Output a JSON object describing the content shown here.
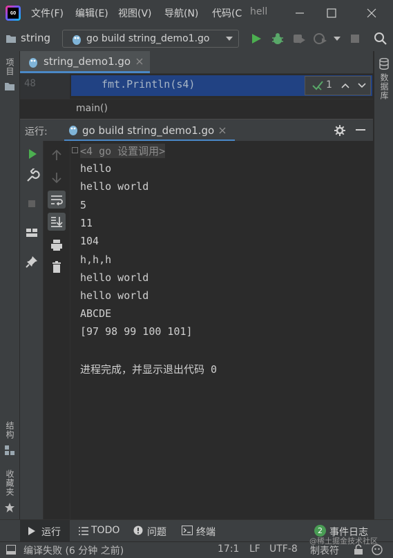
{
  "menu": [
    "文件(F)",
    "编辑(E)",
    "视图(V)",
    "导航(N)",
    "代码(C"
  ],
  "window_title": "hell",
  "toolbar": {
    "project_name": "string",
    "run_config": "go build string_demo1.go"
  },
  "left_strip": {
    "project": "项目",
    "structure": "结构",
    "favorites": "收藏夹"
  },
  "right_strip": {
    "database": "数据库"
  },
  "editor": {
    "tab_label": "string_demo1.go",
    "line_number": "48",
    "code": "fmt.Println(s4)",
    "inspection_count": "1",
    "breadcrumb": "main()"
  },
  "run_panel": {
    "title": "运行:",
    "tab_label": "go build string_demo1.go",
    "fold_text": "<4 go 设置调用>",
    "output": [
      "hello",
      "hello world",
      "5",
      "11",
      "104",
      "h,h,h",
      "hello world",
      "hello world",
      "ABCDE",
      "[97 98 99 100 101]",
      "",
      "进程完成，并显示退出代码 0"
    ]
  },
  "bottom_tools": {
    "run": "运行",
    "todo": "TODO",
    "problems": "问题",
    "terminal": "终端",
    "event_log": "事件日志",
    "event_count": "2"
  },
  "status_bar": {
    "message": "编译失败 (6 分钟 之前)",
    "position": "17:1",
    "line_sep": "LF",
    "encoding": "UTF-8",
    "indent": "制表符",
    "watermark": "@稀土掘金技术社区"
  },
  "colors": {
    "accent": "#4a88c7",
    "run_green": "#4caf50",
    "debug_green": "#59a869",
    "selection": "#214283",
    "event_badge": "#499c54"
  }
}
